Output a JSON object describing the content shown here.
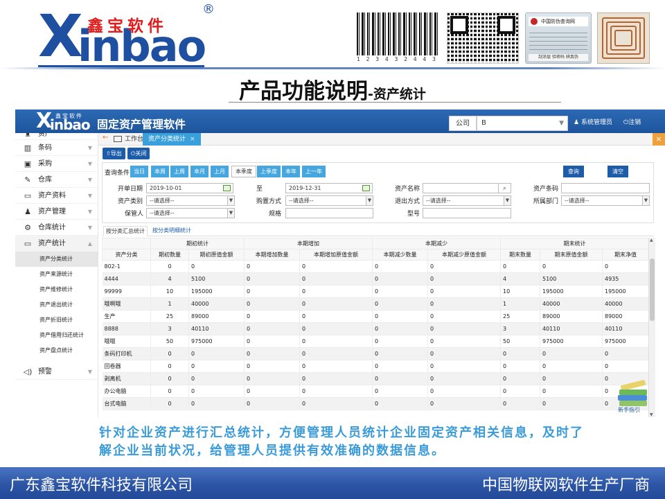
{
  "brand": {
    "logo_x": "X",
    "logo_inbao": "inbao",
    "logo_cn": "鑫宝软件",
    "reg_mark": "®",
    "barcode_digits": "1 2 3 4 3 2 4 4 3 5 1 1 1",
    "label_card_title": "中国防伪查询网",
    "label_card_foot": "刮涂层 验密码 辨真伪"
  },
  "slide": {
    "title": "产品功能说明",
    "subtitle": "-资产统计"
  },
  "app": {
    "logo_x": "X",
    "logo_inbao": "inbao",
    "logo_cn": "鑫宝软件",
    "reg_mark": "®",
    "title": "固定资产管理软件",
    "company_label": "公司",
    "company_value": "B",
    "admin": "系统管理员",
    "logout": "注销"
  },
  "sidebar": {
    "items": [
      {
        "label": "资产",
        "icon": "sack-icon",
        "glyph": "♜"
      },
      {
        "label": "条码",
        "icon": "barcode-icon",
        "glyph": "▥"
      },
      {
        "label": "采购",
        "icon": "card-icon",
        "glyph": "▣"
      },
      {
        "label": "仓库",
        "icon": "edit-icon",
        "glyph": "✎"
      },
      {
        "label": "资产资料",
        "icon": "monitor-icon",
        "glyph": "▭"
      },
      {
        "label": "资产管理",
        "icon": "user-icon",
        "glyph": "♟"
      },
      {
        "label": "仓库统计",
        "icon": "gear-icon",
        "glyph": "⚙"
      },
      {
        "label": "资产统计",
        "icon": "monitor-icon",
        "glyph": "▭"
      }
    ],
    "sub_items": [
      "资产分类统计",
      "资产来源统计",
      "资产维修统计",
      "资产退出统计",
      "资产折旧统计",
      "资产借用归还统计",
      "资产盘点统计"
    ],
    "warning": {
      "label": "预警",
      "icon": "speaker-icon",
      "glyph": "◁)"
    }
  },
  "tabs": {
    "home": "工作台",
    "active": "资产分类统计",
    "close": "×",
    "close_all": "×",
    "back": "←"
  },
  "toolbar": {
    "export": "导出",
    "close": "关闭"
  },
  "query": {
    "label": "查询条件",
    "period_buttons": [
      "当日",
      "本周",
      "上周",
      "本月",
      "上月",
      "本季度",
      "上季度",
      "本年",
      "上一年"
    ],
    "selected_period": "本季度",
    "search": "查询",
    "clear": "清空",
    "start_date_label": "开单日期",
    "start_date": "2019-10-01",
    "to_label": "至",
    "end_date": "2019-12-31",
    "asset_name_label": "资产名称",
    "asset_code_label": "资产条码",
    "asset_type_label": "资产类别",
    "purchase_label": "购置方式",
    "exit_label": "退出方式",
    "dept_label": "所属部门",
    "keeper_label": "保管人",
    "spec_label": "规格",
    "model_label": "型号",
    "select_placeholder": "--请选择--"
  },
  "subtabs": [
    "按分类汇总统计",
    "按分类明细统计"
  ],
  "table": {
    "group_headers": [
      "期初统计",
      "本期增加",
      "本期减少",
      "期末统计"
    ],
    "columns": [
      "资产分类",
      "期初数量",
      "期初原值金额",
      "本期增加数量",
      "本期增加原值金额",
      "本期减少数量",
      "本期减少原值金额",
      "期末数量",
      "期末原值金额",
      "期末净值"
    ],
    "rows": [
      [
        "802-1",
        "0",
        "0",
        "0",
        "0",
        "0",
        "0",
        "0",
        "0",
        "0"
      ],
      [
        "4444",
        "4",
        "5100",
        "0",
        "0",
        "0",
        "0",
        "4",
        "5100",
        "4935"
      ],
      [
        "99999",
        "10",
        "195000",
        "0",
        "0",
        "0",
        "0",
        "10",
        "195000",
        "195000"
      ],
      [
        "哦啊哦",
        "1",
        "40000",
        "0",
        "0",
        "0",
        "0",
        "1",
        "40000",
        "40000"
      ],
      [
        "生产",
        "25",
        "89000",
        "0",
        "0",
        "0",
        "0",
        "25",
        "89000",
        "89000"
      ],
      [
        "8888",
        "3",
        "40110",
        "0",
        "0",
        "0",
        "0",
        "3",
        "40110",
        "40110"
      ],
      [
        "哦哦",
        "50",
        "975000",
        "0",
        "0",
        "0",
        "0",
        "50",
        "975000",
        "975000"
      ],
      [
        "条码打印机",
        "0",
        "0",
        "0",
        "0",
        "0",
        "0",
        "0",
        "0",
        "0"
      ],
      [
        "回卷器",
        "0",
        "0",
        "0",
        "0",
        "0",
        "0",
        "0",
        "0",
        "0"
      ],
      [
        "剥离机",
        "0",
        "0",
        "0",
        "0",
        "0",
        "0",
        "0",
        "0",
        "0"
      ],
      [
        "办公电脑",
        "0",
        "0",
        "0",
        "0",
        "0",
        "0",
        "0",
        "0",
        "0"
      ],
      [
        "台式电脑",
        "0",
        "0",
        "0",
        "0",
        "0",
        "0",
        "0",
        "0",
        "0"
      ]
    ]
  },
  "guide_label": "新手指引",
  "caption": "针对企业资产进行汇总统计，方便管理人员统计企业固定资产相关信息，及时了解企业当前状况，给管理人员提供有效准确的数据信息。",
  "footer": {
    "left": "广东鑫宝软件科技有限公司",
    "right": "中国物联网软件生产厂商"
  }
}
